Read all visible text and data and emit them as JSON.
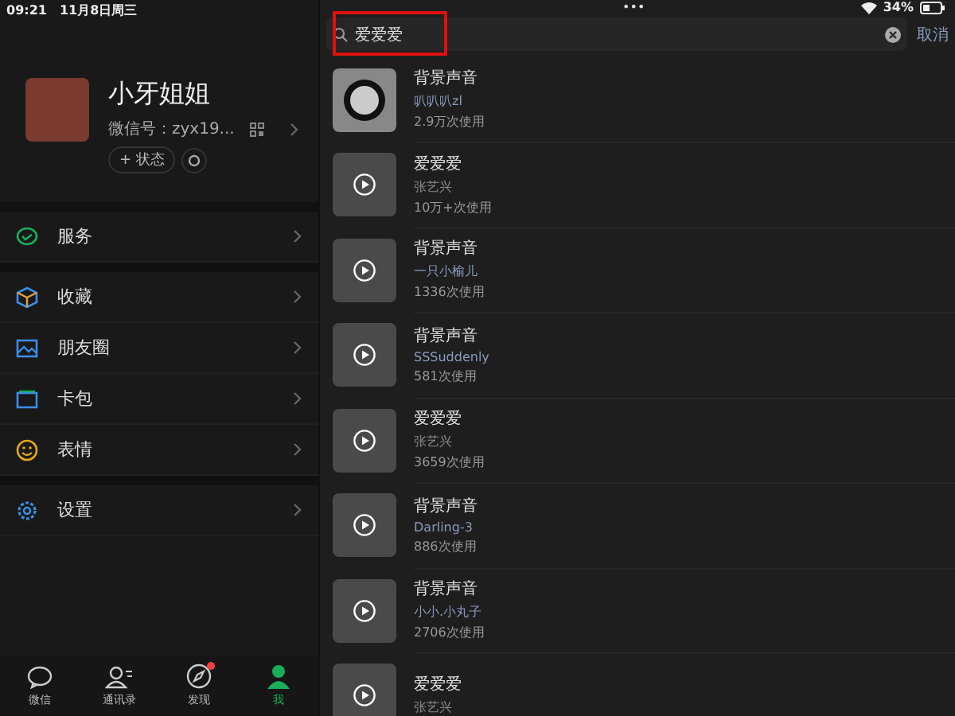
{
  "status_bar": {
    "time": "09:21",
    "date": "11月8日周三",
    "dots": "•••",
    "battery": "34%"
  },
  "profile": {
    "name": "小牙姐姐",
    "wechat_id": "微信号：zyx19...",
    "status_button": "+ 状态"
  },
  "menu_groups": [
    [
      {
        "label": "服务",
        "kind": "service"
      }
    ],
    [
      {
        "label": "收藏",
        "kind": "favorites"
      },
      {
        "label": "朋友圈",
        "kind": "moments"
      },
      {
        "label": "卡包",
        "kind": "cards"
      },
      {
        "label": "表情",
        "kind": "stickers"
      }
    ],
    [
      {
        "label": "设置",
        "kind": "settings"
      }
    ]
  ],
  "tab_bar": [
    {
      "label": "微信",
      "kind": "chat",
      "selected": false,
      "badge": false
    },
    {
      "label": "通讯录",
      "kind": "contacts",
      "selected": false,
      "badge": false
    },
    {
      "label": "发现",
      "kind": "discover",
      "selected": false,
      "badge": true
    },
    {
      "label": "我",
      "kind": "me",
      "selected": true,
      "badge": false
    }
  ],
  "search": {
    "value": "爱爱爱",
    "highlighted": true,
    "cancel": "取消"
  },
  "results": [
    {
      "kind": "disc",
      "title": "背景声音",
      "author": "叭叭叭zl",
      "author_linked": true,
      "usage": "2.9万次使用"
    },
    {
      "kind": "video",
      "title": "爱爱爱",
      "author": "张艺兴",
      "author_linked": false,
      "usage": "10万+次使用"
    },
    {
      "kind": "video",
      "title": "背景声音",
      "author": "一只小榆儿",
      "author_linked": true,
      "usage": "1336次使用"
    },
    {
      "kind": "video",
      "title": "背景声音",
      "author": "SSSuddenly",
      "author_linked": true,
      "usage": "581次使用"
    },
    {
      "kind": "video",
      "title": "爱爱爱",
      "author": "张艺兴",
      "author_linked": false,
      "usage": "3659次使用"
    },
    {
      "kind": "video",
      "title": "背景声音",
      "author": "Darling-3",
      "author_linked": true,
      "usage": "886次使用"
    },
    {
      "kind": "video",
      "title": "背景声音",
      "author": "小小.小丸子",
      "author_linked": true,
      "usage": "2706次使用"
    },
    {
      "kind": "video",
      "title": "爱爱爱",
      "author": "张艺兴",
      "author_linked": false
    }
  ]
}
